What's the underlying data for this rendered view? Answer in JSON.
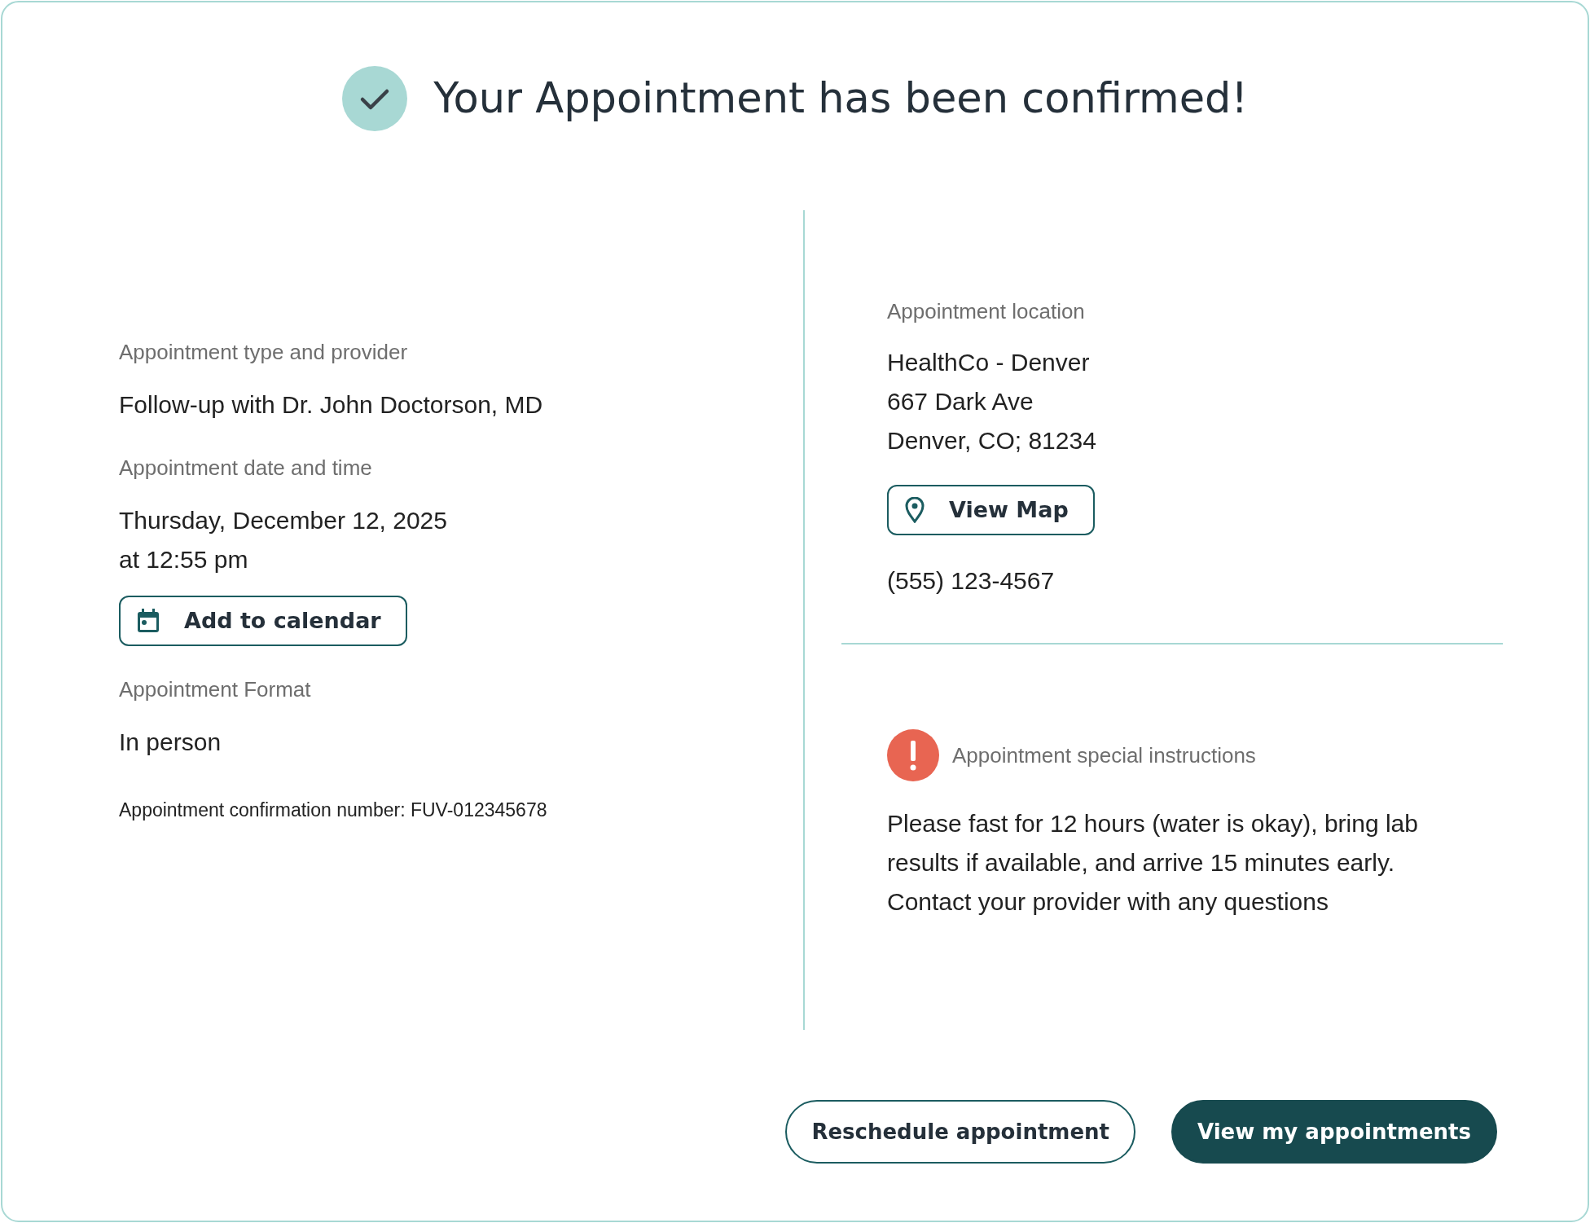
{
  "header": {
    "title": "Your Appointment has been confirmed!"
  },
  "details": [
    {
      "label": "Appointment type and provider",
      "lines": [
        "Follow-up with Dr. John Doctorson, MD"
      ]
    },
    {
      "label": "Appointment date and time",
      "lines": [
        "Thursday, December 12, 2025",
        "at 12:55 pm"
      ],
      "action": {
        "kind": "calendar",
        "label": "Add to calendar"
      }
    },
    {
      "label": "Appointment Format",
      "lines": [
        "In person"
      ]
    }
  ],
  "confirmation": "Appointment confirmation number: FUV-012345678",
  "location": {
    "label": "Appointment location",
    "lines": [
      "HealthCo - Denver",
      "667 Dark Ave",
      "Denver, CO; 81234"
    ],
    "action": {
      "kind": "map",
      "label": "View Map"
    },
    "phone": "(555) 123-4567"
  },
  "instructions": {
    "label": "Appointment special instructions",
    "text": "Please fast for 12 hours (water is okay), bring lab results if available, and arrive 15 minutes early. Contact your provider with any questions"
  },
  "buttons": [
    {
      "label": "Reschedule appointment",
      "kind": "secondary"
    },
    {
      "label": "View my appointments",
      "kind": "primary"
    }
  ]
}
